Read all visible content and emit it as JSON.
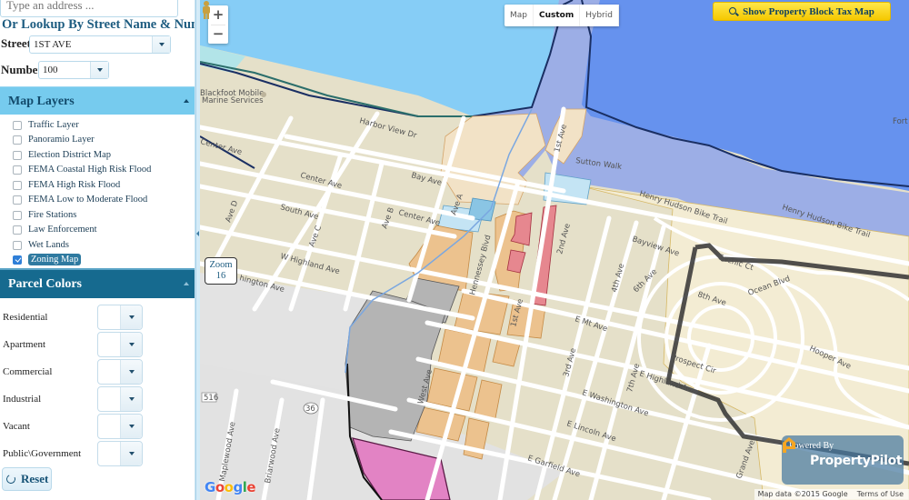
{
  "search": {
    "address_placeholder": "Type an address ...",
    "lookup_title": "Or Lookup By Street Name & Number",
    "street_label": "Street",
    "street_value": "1ST AVE",
    "number_label": "Number",
    "number_value": "100"
  },
  "map_layers": {
    "title": "Map Layers",
    "items": [
      {
        "label": "Traffic Layer",
        "checked": false
      },
      {
        "label": "Panoramio Layer",
        "checked": false
      },
      {
        "label": "Election District Map",
        "checked": false
      },
      {
        "label": "FEMA Coastal High Risk Flood",
        "checked": false
      },
      {
        "label": "FEMA High Risk Flood",
        "checked": false
      },
      {
        "label": "FEMA Low to Moderate Flood",
        "checked": false
      },
      {
        "label": "Fire Stations",
        "checked": false
      },
      {
        "label": "Law Enforcement",
        "checked": false
      },
      {
        "label": "Wet Lands",
        "checked": false
      },
      {
        "label": "Zoning Map",
        "checked": true
      }
    ]
  },
  "parcel_colors": {
    "title": "Parcel Colors",
    "items": [
      {
        "label": "Residential"
      },
      {
        "label": "Apartment"
      },
      {
        "label": "Commercial"
      },
      {
        "label": "Industrial"
      },
      {
        "label": "Vacant"
      },
      {
        "label": "Public\\Government"
      }
    ],
    "reset_label": "Reset"
  },
  "map": {
    "zoom_in": "+",
    "zoom_out": "−",
    "map_types": [
      {
        "label": "Map",
        "active": false
      },
      {
        "label": "Custom",
        "active": true
      },
      {
        "label": "Hybrid",
        "active": false
      }
    ],
    "tax_map_button": "Show Property Block Tax Map",
    "zoom_badge_label": "Zoom",
    "zoom_level": "16",
    "powered_by": "Powered By",
    "brand_name": "PropertyPilot",
    "attribution": "Map data ©2015 Google",
    "terms": "Terms of Use",
    "google_logo": [
      "G",
      "o",
      "o",
      "g",
      "l",
      "e"
    ],
    "labels": {
      "poi": "Blackfoot Mobile",
      "poi2": "Marine Services",
      "harbor_view": "Harbor View Dr",
      "bay_ave": "Bay Ave",
      "center_ave_w": "Center Ave",
      "center_ave": "Center Ave",
      "south_ave": "South Ave",
      "ave_d": "Ave D",
      "ave_c": "Ave C",
      "ave_b": "Ave B",
      "ave_a": "Ave A",
      "w_highland": "W Highland Ave",
      "washington_w": "hington Ave",
      "sutton_walk": "Sutton Walk",
      "first_ave_n": "1st Ave",
      "henry_hudson": "Henry Hudson Bike Trail",
      "henry_hudson_2": "Henry Hudson",
      "fort": "Fort H",
      "bayview": "Bayview Ave",
      "scenic": "Scenic Ct",
      "ocean": "Ocean Blvd",
      "eighth_ave": "8th Ave",
      "sixth_ave": "6th Ave",
      "fourth_ave": "4th Ave",
      "hennessey": "Hennessey Blvd",
      "second_ave": "2nd Ave",
      "first_ave": "1st Ave",
      "third_ave": "3rd Ave",
      "e_mt_ave": "E Mt Ave",
      "west_ave": "West Ave",
      "seventh_ave": "7th Ave",
      "prospect": "Prospect Cir",
      "e_highland": "E Highland Ave",
      "e_washington": "E Washington Ave",
      "e_lincoln": "E Lincoln Ave",
      "e_garfield": "E Garfield Ave",
      "grand_ave": "Grand Ave",
      "central_ave": "Central Ave",
      "hooper": "Hooper Ave",
      "maplewood": "Maplewood Ave",
      "briarwood": "Briarwood Ave",
      "route_516": "516",
      "route_36": "36"
    }
  },
  "colors": {
    "water": "#86cdf6",
    "flood_zone": "#6692ee",
    "flood_zone_light": "#9caee6",
    "land": "#e5e0c9",
    "residential_light": "#f3ecd3",
    "commercial": "#ecc28e",
    "retail": "#e6878f",
    "industrial": "#b4b4b4",
    "public": "#e283c4",
    "park_blue": "#bddff0",
    "accent_button": "#f5c800",
    "header_dark": "#166a8f",
    "header_light": "#76cbee"
  }
}
